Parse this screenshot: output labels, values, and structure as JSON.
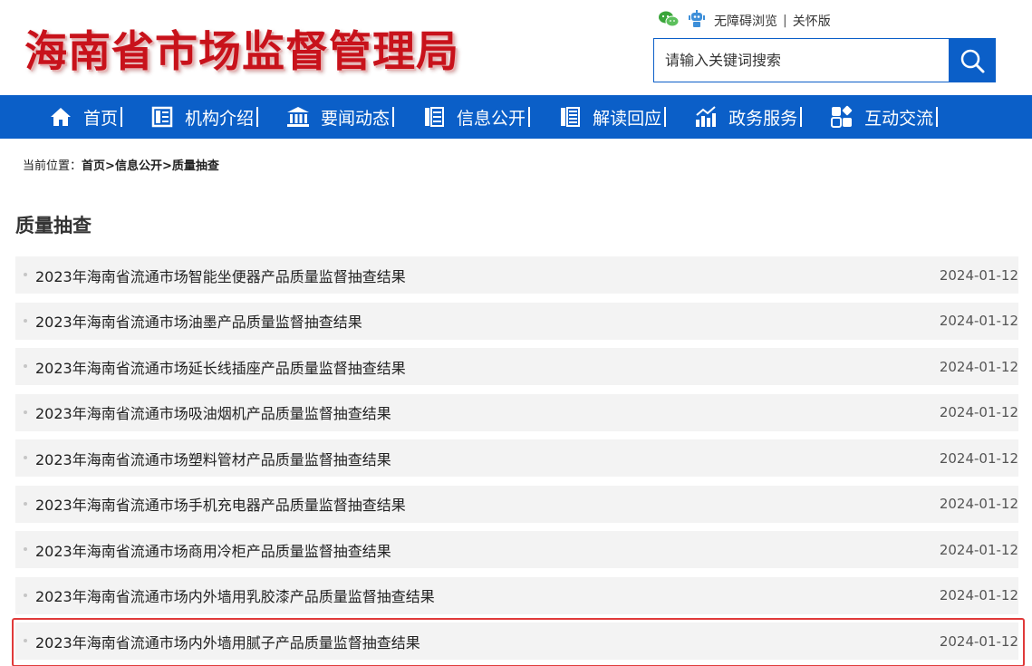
{
  "header": {
    "logo_text": "海南省市场监督管理局",
    "accessibility_label": "无障碍浏览",
    "care_label": "关怀版",
    "separator": "|",
    "search_placeholder": "请输入关键词搜索"
  },
  "nav": {
    "items": [
      {
        "label": "首页",
        "icon": "home-icon"
      },
      {
        "label": "机构介绍",
        "icon": "org-icon"
      },
      {
        "label": "要闻动态",
        "icon": "building-icon"
      },
      {
        "label": "信息公开",
        "icon": "info-icon"
      },
      {
        "label": "解读回应",
        "icon": "interpret-icon"
      },
      {
        "label": "政务服务",
        "icon": "service-icon"
      },
      {
        "label": "互动交流",
        "icon": "interact-icon"
      }
    ]
  },
  "breadcrumb": {
    "prefix": "当前位置：",
    "items": [
      "首页",
      "信息公开",
      "质量抽查"
    ],
    "separator": ">"
  },
  "section_title": "质量抽查",
  "list": [
    {
      "title": "2023年海南省流通市场智能坐便器产品质量监督抽查结果",
      "date": "2024-01-12"
    },
    {
      "title": "2023年海南省流通市场油墨产品质量监督抽查结果",
      "date": "2024-01-12"
    },
    {
      "title": "2023年海南省流通市场延长线插座产品质量监督抽查结果",
      "date": "2024-01-12"
    },
    {
      "title": "2023年海南省流通市场吸油烟机产品质量监督抽查结果",
      "date": "2024-01-12"
    },
    {
      "title": "2023年海南省流通市场塑料管材产品质量监督抽查结果",
      "date": "2024-01-12"
    },
    {
      "title": "2023年海南省流通市场手机充电器产品质量监督抽查结果",
      "date": "2024-01-12"
    },
    {
      "title": "2023年海南省流通市场商用冷柜产品质量监督抽查结果",
      "date": "2024-01-12"
    },
    {
      "title": "2023年海南省流通市场内外墙用乳胶漆产品质量监督抽查结果",
      "date": "2024-01-12"
    },
    {
      "title": "2023年海南省流通市场内外墙用腻子产品质量监督抽查结果",
      "date": "2024-01-12"
    }
  ],
  "colors": {
    "brand_blue": "#0b5fc8",
    "logo_red": "#c8121b",
    "highlight_red": "#e03a3a",
    "row_bg": "#f3f3f3"
  }
}
